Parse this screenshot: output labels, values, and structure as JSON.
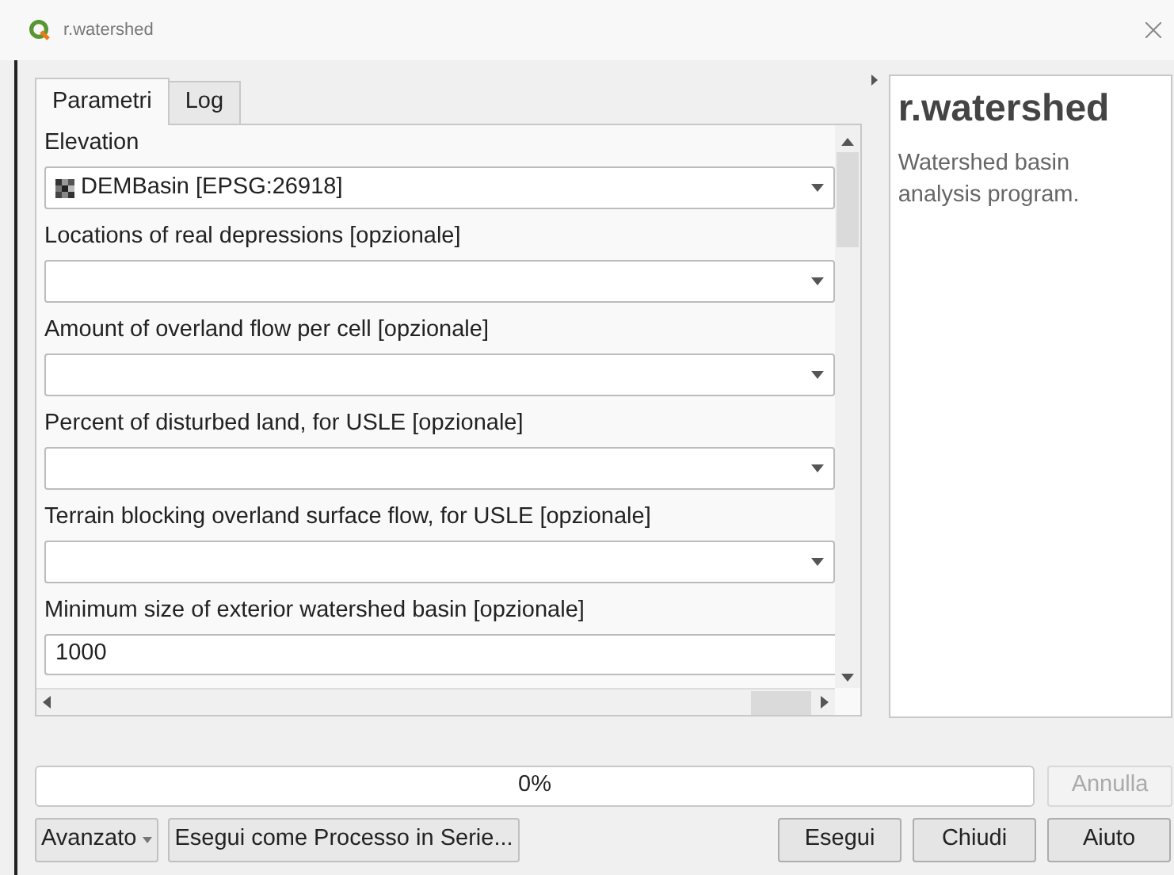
{
  "window": {
    "title": "r.watershed"
  },
  "tabs": [
    {
      "label": "Parametri",
      "selected": true
    },
    {
      "label": "Log",
      "selected": false
    }
  ],
  "parameters": [
    {
      "label": "Elevation",
      "kind": "combo",
      "value": "DEMBasin [EPSG:26918]"
    },
    {
      "label": "Locations of real depressions [opzionale]",
      "kind": "combo"
    },
    {
      "label": "Amount of overland flow per cell [opzionale]",
      "kind": "combo"
    },
    {
      "label": "Percent of disturbed land, for USLE [opzionale]",
      "kind": "combo"
    },
    {
      "label": "Terrain blocking overland surface flow, for USLE [opzionale]",
      "kind": "combo"
    },
    {
      "label": "Minimum size of exterior watershed basin [opzionale]",
      "kind": "number",
      "value": "1000"
    }
  ],
  "help": {
    "title": "r.watershed",
    "description": "Watershed basin analysis program."
  },
  "progress": {
    "level": 0,
    "reading": "0%"
  },
  "cancel_button": {
    "label": "Annulla",
    "disabled": true
  },
  "left_buttons": [
    {
      "label": "Avanzato",
      "kind": "menu"
    },
    {
      "label": "Esegui come Processo in Serie...",
      "kind": "plain"
    }
  ],
  "right_buttons": [
    "Esegui",
    "Chiudi",
    "Aiuto"
  ]
}
